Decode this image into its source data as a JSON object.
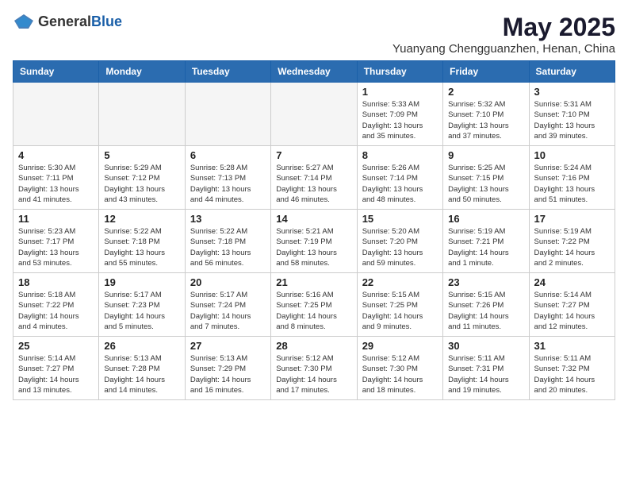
{
  "header": {
    "logo_general": "General",
    "logo_blue": "Blue",
    "main_title": "May 2025",
    "subtitle": "Yuanyang Chengguanzhen, Henan, China"
  },
  "calendar": {
    "days_of_week": [
      "Sunday",
      "Monday",
      "Tuesday",
      "Wednesday",
      "Thursday",
      "Friday",
      "Saturday"
    ],
    "weeks": [
      {
        "days": [
          {
            "date": "",
            "info": ""
          },
          {
            "date": "",
            "info": ""
          },
          {
            "date": "",
            "info": ""
          },
          {
            "date": "",
            "info": ""
          },
          {
            "date": "1",
            "info": "Sunrise: 5:33 AM\nSunset: 7:09 PM\nDaylight: 13 hours\nand 35 minutes."
          },
          {
            "date": "2",
            "info": "Sunrise: 5:32 AM\nSunset: 7:10 PM\nDaylight: 13 hours\nand 37 minutes."
          },
          {
            "date": "3",
            "info": "Sunrise: 5:31 AM\nSunset: 7:10 PM\nDaylight: 13 hours\nand 39 minutes."
          }
        ]
      },
      {
        "days": [
          {
            "date": "4",
            "info": "Sunrise: 5:30 AM\nSunset: 7:11 PM\nDaylight: 13 hours\nand 41 minutes."
          },
          {
            "date": "5",
            "info": "Sunrise: 5:29 AM\nSunset: 7:12 PM\nDaylight: 13 hours\nand 43 minutes."
          },
          {
            "date": "6",
            "info": "Sunrise: 5:28 AM\nSunset: 7:13 PM\nDaylight: 13 hours\nand 44 minutes."
          },
          {
            "date": "7",
            "info": "Sunrise: 5:27 AM\nSunset: 7:14 PM\nDaylight: 13 hours\nand 46 minutes."
          },
          {
            "date": "8",
            "info": "Sunrise: 5:26 AM\nSunset: 7:14 PM\nDaylight: 13 hours\nand 48 minutes."
          },
          {
            "date": "9",
            "info": "Sunrise: 5:25 AM\nSunset: 7:15 PM\nDaylight: 13 hours\nand 50 minutes."
          },
          {
            "date": "10",
            "info": "Sunrise: 5:24 AM\nSunset: 7:16 PM\nDaylight: 13 hours\nand 51 minutes."
          }
        ]
      },
      {
        "days": [
          {
            "date": "11",
            "info": "Sunrise: 5:23 AM\nSunset: 7:17 PM\nDaylight: 13 hours\nand 53 minutes."
          },
          {
            "date": "12",
            "info": "Sunrise: 5:22 AM\nSunset: 7:18 PM\nDaylight: 13 hours\nand 55 minutes."
          },
          {
            "date": "13",
            "info": "Sunrise: 5:22 AM\nSunset: 7:18 PM\nDaylight: 13 hours\nand 56 minutes."
          },
          {
            "date": "14",
            "info": "Sunrise: 5:21 AM\nSunset: 7:19 PM\nDaylight: 13 hours\nand 58 minutes."
          },
          {
            "date": "15",
            "info": "Sunrise: 5:20 AM\nSunset: 7:20 PM\nDaylight: 13 hours\nand 59 minutes."
          },
          {
            "date": "16",
            "info": "Sunrise: 5:19 AM\nSunset: 7:21 PM\nDaylight: 14 hours\nand 1 minute."
          },
          {
            "date": "17",
            "info": "Sunrise: 5:19 AM\nSunset: 7:22 PM\nDaylight: 14 hours\nand 2 minutes."
          }
        ]
      },
      {
        "days": [
          {
            "date": "18",
            "info": "Sunrise: 5:18 AM\nSunset: 7:22 PM\nDaylight: 14 hours\nand 4 minutes."
          },
          {
            "date": "19",
            "info": "Sunrise: 5:17 AM\nSunset: 7:23 PM\nDaylight: 14 hours\nand 5 minutes."
          },
          {
            "date": "20",
            "info": "Sunrise: 5:17 AM\nSunset: 7:24 PM\nDaylight: 14 hours\nand 7 minutes."
          },
          {
            "date": "21",
            "info": "Sunrise: 5:16 AM\nSunset: 7:25 PM\nDaylight: 14 hours\nand 8 minutes."
          },
          {
            "date": "22",
            "info": "Sunrise: 5:15 AM\nSunset: 7:25 PM\nDaylight: 14 hours\nand 9 minutes."
          },
          {
            "date": "23",
            "info": "Sunrise: 5:15 AM\nSunset: 7:26 PM\nDaylight: 14 hours\nand 11 minutes."
          },
          {
            "date": "24",
            "info": "Sunrise: 5:14 AM\nSunset: 7:27 PM\nDaylight: 14 hours\nand 12 minutes."
          }
        ]
      },
      {
        "days": [
          {
            "date": "25",
            "info": "Sunrise: 5:14 AM\nSunset: 7:27 PM\nDaylight: 14 hours\nand 13 minutes."
          },
          {
            "date": "26",
            "info": "Sunrise: 5:13 AM\nSunset: 7:28 PM\nDaylight: 14 hours\nand 14 minutes."
          },
          {
            "date": "27",
            "info": "Sunrise: 5:13 AM\nSunset: 7:29 PM\nDaylight: 14 hours\nand 16 minutes."
          },
          {
            "date": "28",
            "info": "Sunrise: 5:12 AM\nSunset: 7:30 PM\nDaylight: 14 hours\nand 17 minutes."
          },
          {
            "date": "29",
            "info": "Sunrise: 5:12 AM\nSunset: 7:30 PM\nDaylight: 14 hours\nand 18 minutes."
          },
          {
            "date": "30",
            "info": "Sunrise: 5:11 AM\nSunset: 7:31 PM\nDaylight: 14 hours\nand 19 minutes."
          },
          {
            "date": "31",
            "info": "Sunrise: 5:11 AM\nSunset: 7:32 PM\nDaylight: 14 hours\nand 20 minutes."
          }
        ]
      }
    ]
  }
}
